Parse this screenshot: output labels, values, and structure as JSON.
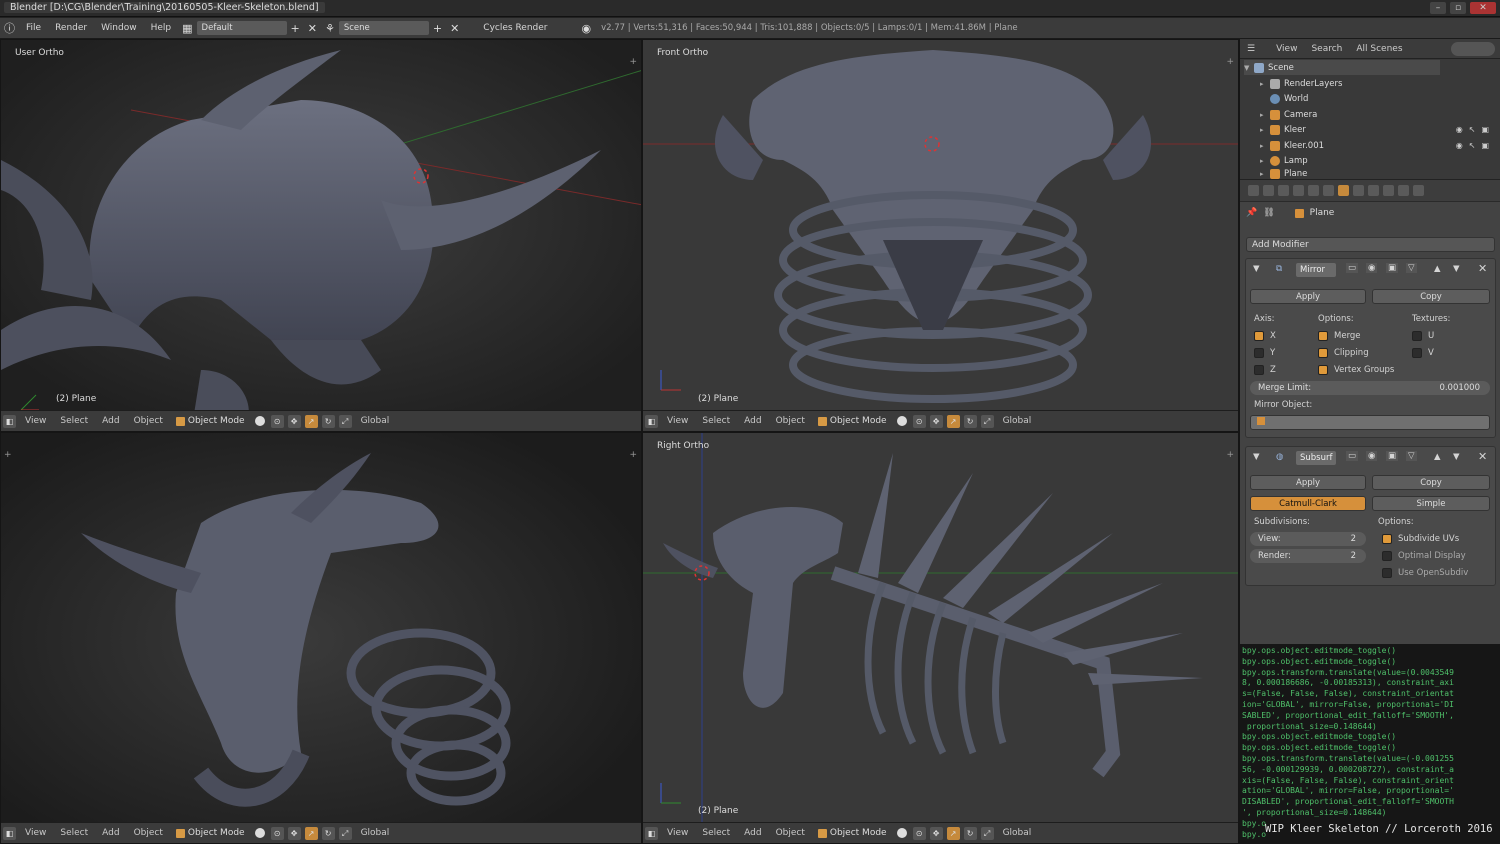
{
  "window": {
    "title": "Blender [D:\\CG\\Blender\\Training\\20160505-Kleer-Skeleton.blend]"
  },
  "menubar": {
    "items": [
      "File",
      "Render",
      "Window",
      "Help"
    ],
    "layout": "Default",
    "scene": "Scene",
    "engine": "Cycles Render",
    "stats": "v2.77 | Verts:51,316 | Faces:50,944 | Tris:101,888 | Objects:0/5 | Lamps:0/1 | Mem:41.86M | Plane"
  },
  "viewports": [
    {
      "label": "User Ortho",
      "object": "(2) Plane"
    },
    {
      "label": "Front Ortho",
      "object": "(2) Plane"
    },
    {
      "label": "",
      "object": ""
    },
    {
      "label": "Right Ortho",
      "object": "(2) Plane"
    }
  ],
  "viewport_header": {
    "view": "View",
    "select": "Select",
    "add": "Add",
    "object": "Object",
    "mode": "Object Mode",
    "orientation": "Global"
  },
  "outliner": {
    "header": {
      "view": "View",
      "search": "Search",
      "filter": "All Scenes"
    },
    "rows": [
      {
        "name": "Scene",
        "color": "#8fa8c8"
      },
      {
        "name": "RenderLayers",
        "color": "#aaaaaa"
      },
      {
        "name": "World",
        "color": "#6b8fb5"
      },
      {
        "name": "Camera",
        "color": "#d6903b"
      },
      {
        "name": "Kleer",
        "color": "#d6903b"
      },
      {
        "name": "Kleer.001",
        "color": "#d6903b"
      },
      {
        "name": "Lamp",
        "color": "#d6903b"
      },
      {
        "name": "Plane",
        "color": "#d6903b"
      }
    ]
  },
  "properties": {
    "context_object": "Plane",
    "add_modifier": "Add Modifier",
    "mirror": {
      "name": "Mirror",
      "apply": "Apply",
      "copy": "Copy",
      "axis_label": "Axis:",
      "options_label": "Options:",
      "textures_label": "Textures:",
      "axis": [
        "X",
        "Y",
        "Z"
      ],
      "options": [
        "Merge",
        "Clipping",
        "Vertex Groups"
      ],
      "textures": [
        "U",
        "V"
      ],
      "merge_limit_label": "Merge Limit:",
      "merge_limit": "0.001000",
      "mirror_object_label": "Mirror Object:"
    },
    "subsurf": {
      "name": "Subsurf",
      "apply": "Apply",
      "copy": "Copy",
      "catmull": "Catmull-Clark",
      "simple": "Simple",
      "subdivisions_label": "Subdivisions:",
      "options_label": "Options:",
      "view_label": "View:",
      "view": "2",
      "render_label": "Render:",
      "render": "2",
      "options": [
        "Subdivide UVs",
        "Optimal Display",
        "Use OpenSubdiv"
      ]
    }
  },
  "console": [
    "bpy.ops.object.editmode_toggle()",
    "bpy.ops.object.editmode_toggle()",
    "bpy.ops.transform.translate(value=(0.0043549",
    "8, 0.000186686, -0.00185313), constraint_axi",
    "s=(False, False, False), constraint_orientat",
    "ion='GLOBAL', mirror=False, proportional='DI",
    "SABLED', proportional_edit_falloff='SMOOTH',",
    " proportional_size=0.148644)",
    "bpy.ops.object.editmode_toggle()",
    "bpy.ops.object.editmode_toggle()",
    "bpy.ops.transform.translate(value=(-0.001255",
    "56, -0.000129939, 0.000208727), constraint_a",
    "xis=(False, False, False), constraint_orient",
    "ation='GLOBAL', mirror=False, proportional='",
    "DISABLED', proportional_edit_falloff='SMOOTH",
    "', proportional_size=0.148644)",
    "bpy.o",
    "bpy.o"
  ],
  "watermark": "WIP Kleer Skeleton // Lorceroth 2016",
  "colors": {
    "accent": "#d6903b",
    "viewport_bg": "#3b3b3b",
    "console_text": "#4fc06a"
  }
}
